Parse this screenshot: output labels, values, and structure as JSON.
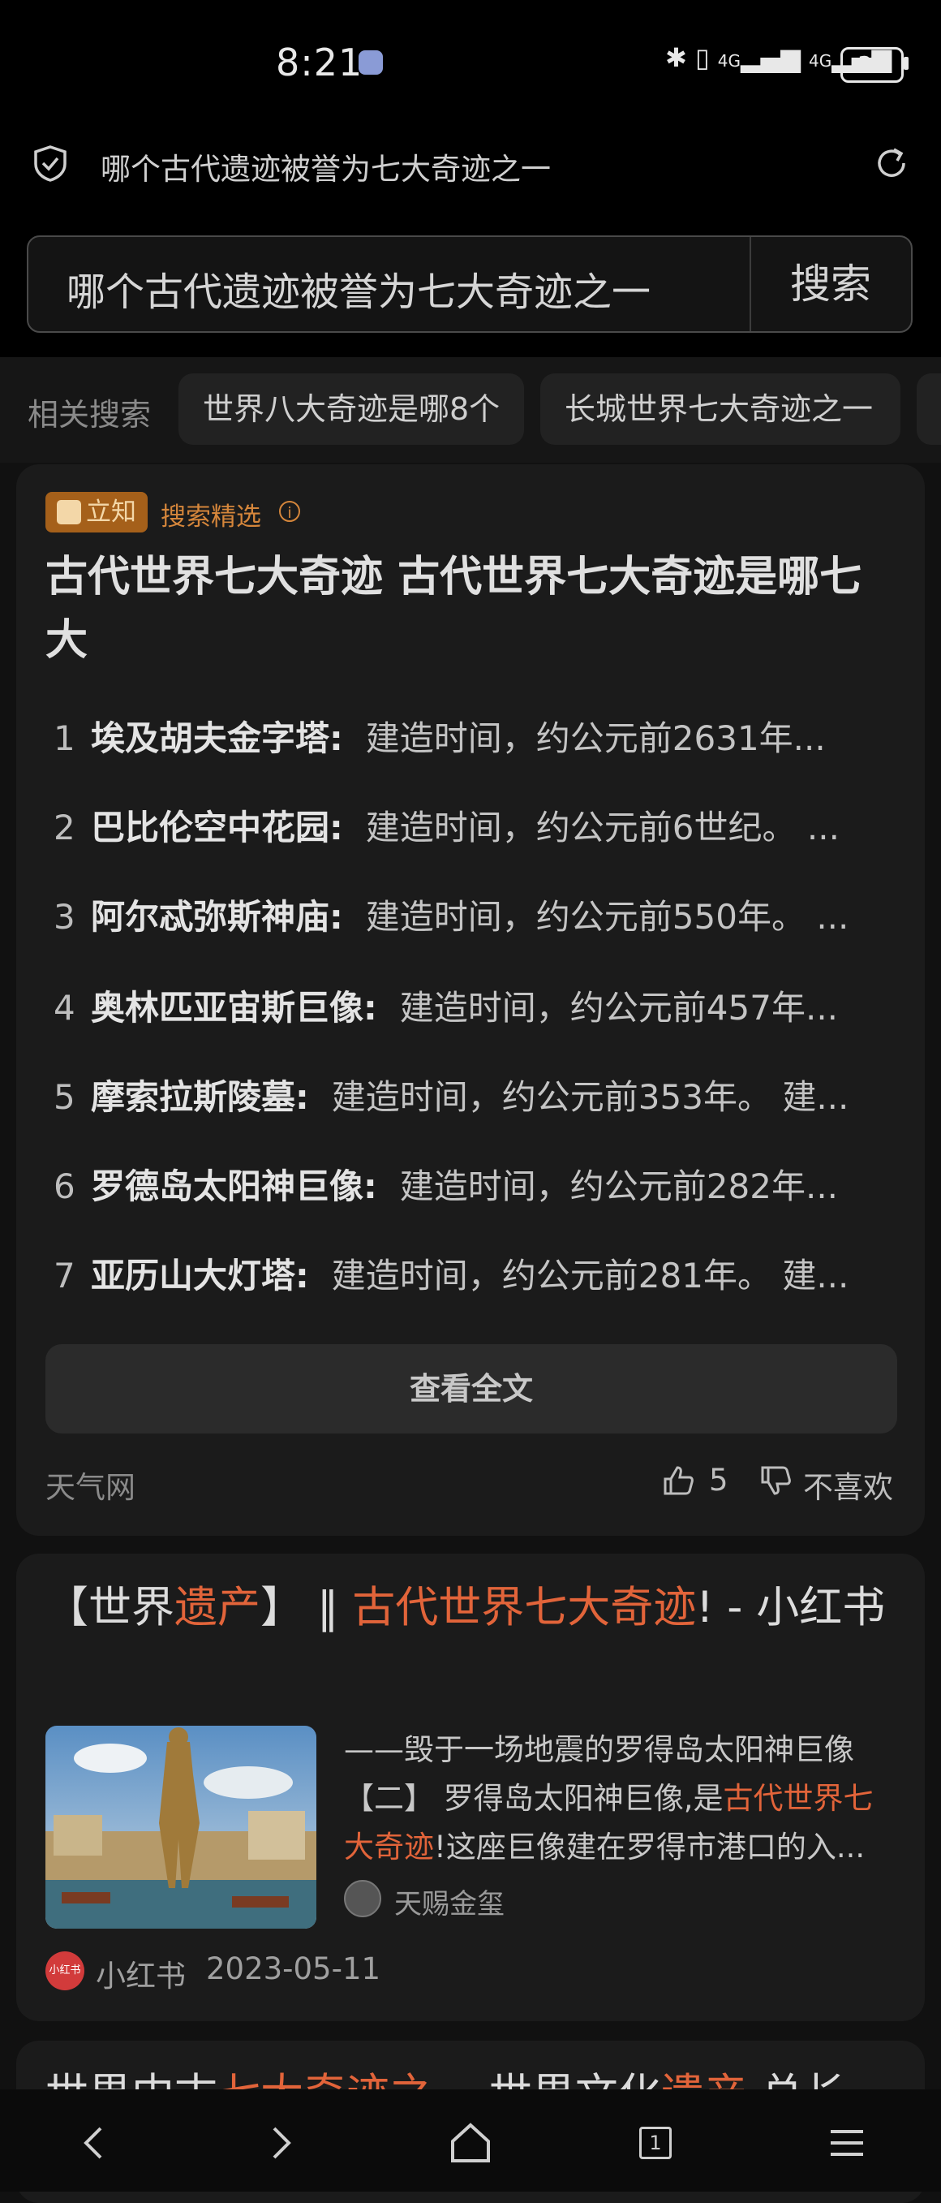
{
  "status_bar": {
    "time": "8:21",
    "network": "4G",
    "network2": "4G",
    "battery": "38"
  },
  "address_bar": {
    "text": "哪个古代遗迹被誉为七大奇迹之一"
  },
  "search": {
    "query": "哪个古代遗迹被誉为七大奇迹之一",
    "button_label": "搜索"
  },
  "related": {
    "label": "相关搜索",
    "chips": [
      "世界八大奇迹是哪8个",
      "长城世界七大奇迹之一"
    ]
  },
  "card1": {
    "badge": "立知",
    "badge_label": "搜索精选",
    "info_icon": "i",
    "title": "古代世界七大奇迹 古代世界七大奇迹是哪七大",
    "items": [
      {
        "num": "1",
        "name": "埃及胡夫金字塔:",
        "desc": "建造时间，约公元前2631年..."
      },
      {
        "num": "2",
        "name": "巴比伦空中花园:",
        "desc": "建造时间，约公元前6世纪。 ..."
      },
      {
        "num": "3",
        "name": "阿尔忒弥斯神庙:",
        "desc": "建造时间，约公元前550年。 ..."
      },
      {
        "num": "4",
        "name": "奥林匹亚宙斯巨像:",
        "desc": "建造时间，约公元前457年..."
      },
      {
        "num": "5",
        "name": "摩索拉斯陵墓:",
        "desc": "建造时间，约公元前353年。 建..."
      },
      {
        "num": "6",
        "name": "罗德岛太阳神巨像:",
        "desc": "建造时间，约公元前282年..."
      },
      {
        "num": "7",
        "name": "亚历山大灯塔:",
        "desc": "建造时间，约公元前281年。 建..."
      }
    ],
    "view_all": "查看全文",
    "source": "天气网",
    "likes": "5",
    "dislike_label": "不喜欢"
  },
  "card2": {
    "title_parts": [
      "【世界",
      "遗产",
      "】 ‖ ",
      "古代世界七大奇迹",
      "! - 小红书"
    ],
    "snippet_line1": "——毁于一场地震的罗得岛太阳神巨像",
    "snippet_part1": "【二】 罗得岛太阳神巨像,是",
    "snippet_hl": "古代世界七大奇迹",
    "snippet_part2": "!这座巨像建在罗得市港口的入...",
    "author": "天赐金玺",
    "source_logo": "小红书",
    "source": "小红书",
    "date": "2023-05-11"
  },
  "card3": {
    "title_parts": [
      "世界中古",
      "七大奇迹之",
      "一 世界文化",
      "遗产",
      " 总长"
    ]
  },
  "colors": {
    "highlight": "#e2643a",
    "badge": "#a5601a",
    "background": "#111111"
  },
  "bottom_nav": {
    "tabs_count": "1",
    "icons": [
      "back-icon",
      "forward-icon",
      "home-icon",
      "tabs-icon",
      "menu-icon"
    ]
  }
}
